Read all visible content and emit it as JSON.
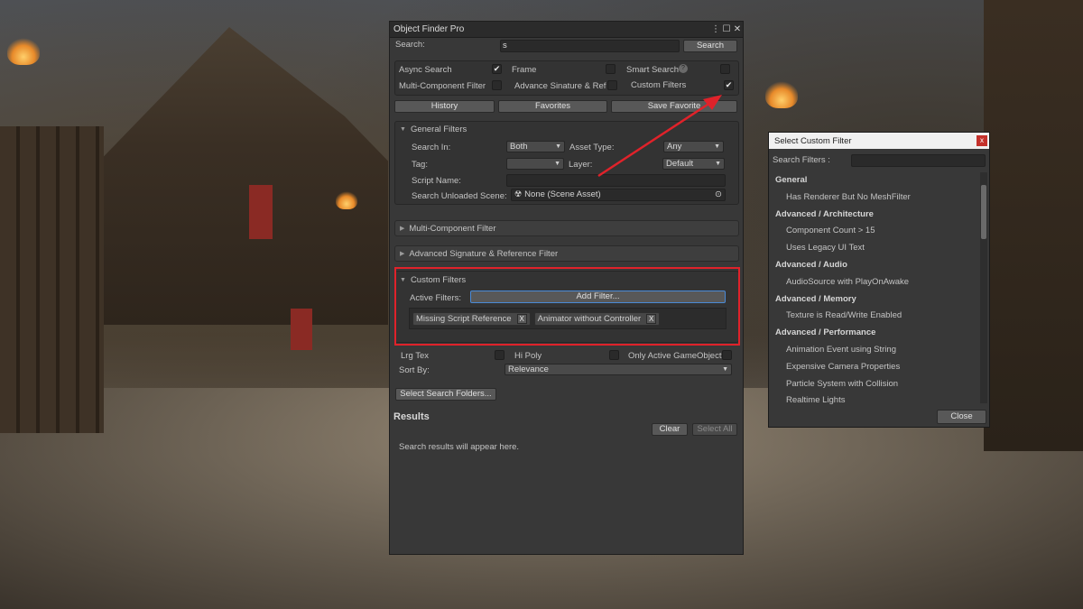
{
  "window": {
    "title": "Object Finder Pro",
    "menu_icon": "kebab-menu-icon",
    "maximize_icon": "maximize-icon",
    "close_icon": "close-icon"
  },
  "search": {
    "label": "Search:",
    "value": "s",
    "button": "Search"
  },
  "options": {
    "async_search": "Async Search",
    "frame": "Frame",
    "smart_search": "Smart Search",
    "multi_component": "Multi-Component Filter",
    "advance_signature": "Advance Sinature & Ref",
    "custom_filters": "Custom Filters",
    "help_glyph": "?"
  },
  "nav_buttons": {
    "history": "History",
    "favorites": "Favorites",
    "save_favorite": "Save Favorite"
  },
  "general_filters": {
    "title": "General Filters",
    "search_in_label": "Search In:",
    "search_in_value": "Both",
    "asset_type_label": "Asset Type:",
    "asset_type_value": "Any",
    "tag_label": "Tag:",
    "tag_value": "",
    "layer_label": "Layer:",
    "layer_value": "Default",
    "script_name_label": "Script Name:",
    "script_name_value": "",
    "unloaded_scene_label": "Search Unloaded Scene:",
    "unloaded_scene_value": "None (Scene Asset)"
  },
  "foldouts": {
    "multi_component": "Multi-Component Filter",
    "advanced_signature": "Advanced Signature & Reference Filter"
  },
  "custom_filters_section": {
    "title": "Custom Filters",
    "active_label": "Active Filters:",
    "add_button": "Add Filter...",
    "chips": [
      {
        "label": "Missing Script Reference",
        "remove": "X"
      },
      {
        "label": "Animator without Controller",
        "remove": "X"
      }
    ]
  },
  "extra_options": {
    "lrg_tex": "Lrg Tex",
    "hi_poly": "Hi Poly",
    "only_active": "Only Active GameObject",
    "sort_label": "Sort By:",
    "sort_value": "Relevance",
    "select_folders": "Select Search Folders..."
  },
  "results": {
    "title": "Results",
    "clear": "Clear",
    "select_all": "Select All",
    "placeholder": "Search results will appear here."
  },
  "dialog": {
    "title": "Select Custom Filter",
    "close_glyph": "x",
    "search_label": "Search Filters :",
    "close_button": "Close",
    "groups": [
      {
        "name": "General",
        "items": [
          "Has Renderer But No MeshFilter"
        ]
      },
      {
        "name": "Advanced / Architecture",
        "items": [
          "Component Count > 15",
          "Uses Legacy UI Text"
        ]
      },
      {
        "name": "Advanced / Audio",
        "items": [
          "AudioSource with PlayOnAwake"
        ]
      },
      {
        "name": "Advanced / Memory",
        "items": [
          "Texture is Read/Write Enabled"
        ]
      },
      {
        "name": "Advanced / Performance",
        "items": [
          "Animation Event using String",
          "Expensive Camera Properties",
          "Particle System with Collision",
          "Realtime Lights"
        ]
      }
    ]
  },
  "colors": {
    "highlight_box": "#e0222a",
    "arrow": "#e0222a"
  }
}
